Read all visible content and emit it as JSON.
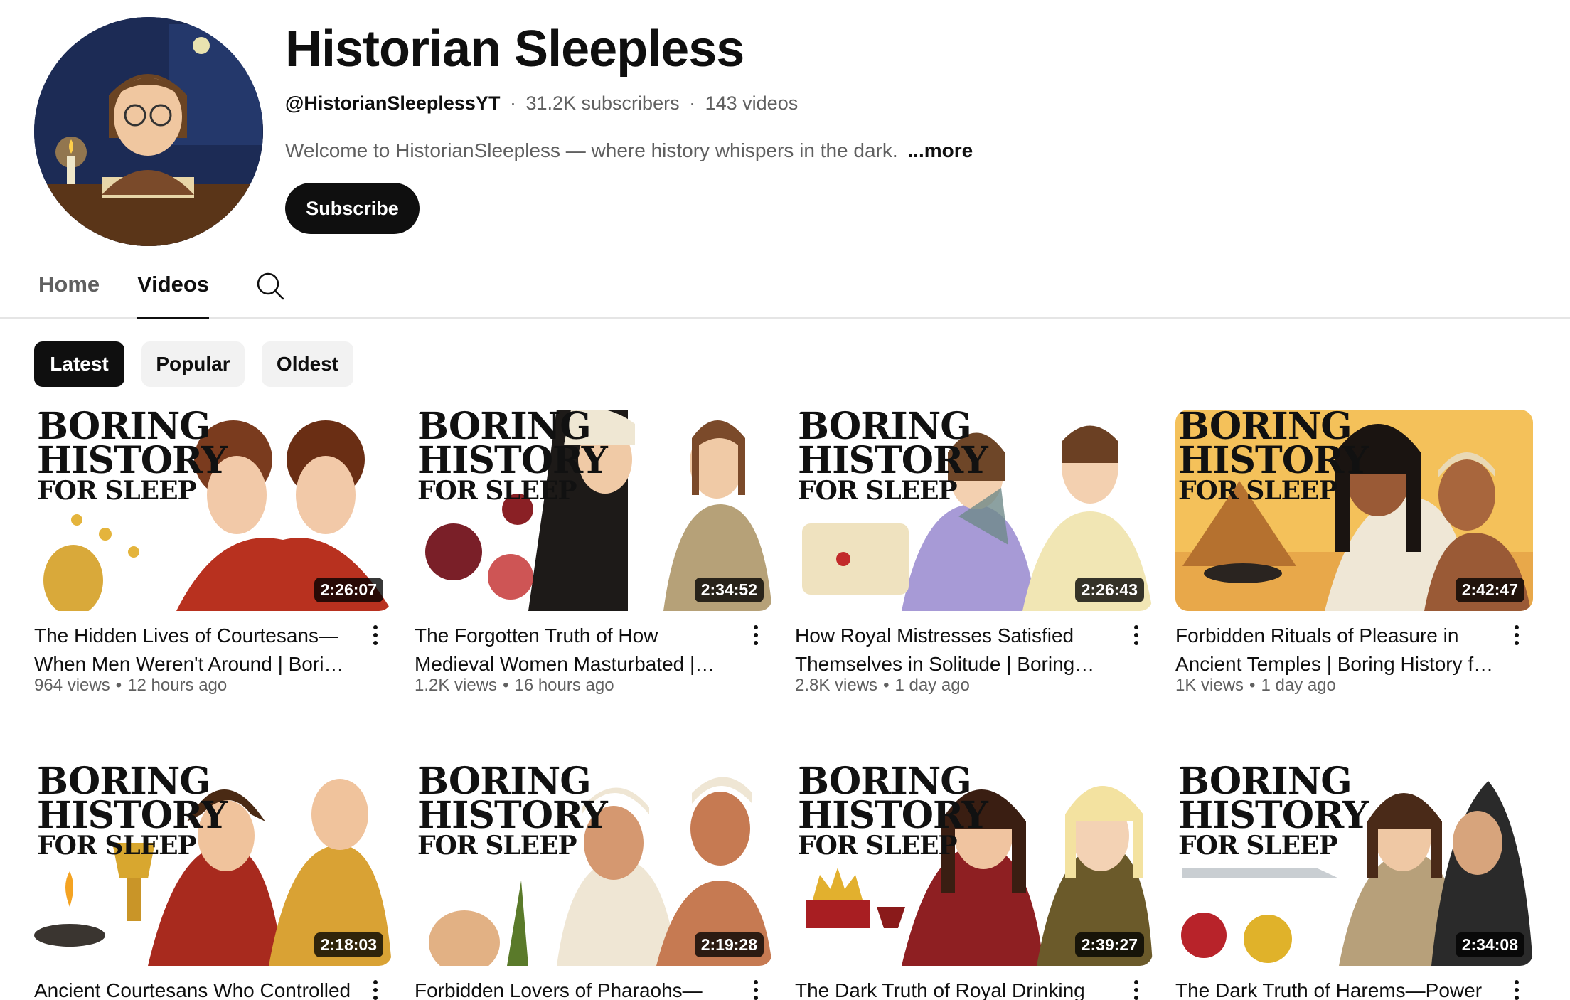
{
  "channel": {
    "name": "Historian Sleepless",
    "handle": "@HistorianSleeplessYT",
    "subscribers": "31.2K subscribers",
    "video_count": "143 videos",
    "meta_separator": "·",
    "description": "Welcome to HistorianSleepless — where history whispers in the dark.",
    "more_label": "...more",
    "subscribe_label": "Subscribe"
  },
  "tabs": [
    {
      "label": "Home",
      "active": false
    },
    {
      "label": "Videos",
      "active": true
    }
  ],
  "chips": [
    {
      "label": "Latest",
      "active": true
    },
    {
      "label": "Popular",
      "active": false
    },
    {
      "label": "Oldest",
      "active": false
    }
  ],
  "thumbnail_text": {
    "line1": "BORING",
    "line2": "HISTORY",
    "line3": "FOR SLEEP"
  },
  "meta_separator": "•",
  "videos": [
    {
      "title": "The Hidden Lives of Courtesans—When Men Weren't Around | Boring History for Sleep",
      "duration": "2:26:07",
      "views": "964 views",
      "age": "12 hours ago"
    },
    {
      "title": "The Forgotten Truth of How Medieval Women Masturbated | Boring History for Sleep",
      "duration": "2:34:52",
      "views": "1.2K views",
      "age": "16 hours ago"
    },
    {
      "title": "How Royal Mistresses Satisfied Themselves in Solitude | Boring History for Sleep",
      "duration": "2:26:43",
      "views": "2.8K views",
      "age": "1 day ago"
    },
    {
      "title": "Forbidden Rituals of Pleasure in Ancient Temples | Boring History for Sleep",
      "duration": "2:42:47",
      "views": "1K views",
      "age": "1 day ago"
    },
    {
      "title": "Ancient Courtesans Who Controlled",
      "duration": "2:18:03",
      "views": "",
      "age": ""
    },
    {
      "title": "Forbidden Lovers of Pharaohs—",
      "duration": "2:19:28",
      "views": "",
      "age": ""
    },
    {
      "title": "The Dark Truth of Royal Drinking",
      "duration": "2:39:27",
      "views": "",
      "age": ""
    },
    {
      "title": "The Dark Truth of Harems—Power",
      "duration": "2:34:08",
      "views": "",
      "age": ""
    }
  ],
  "icons": {
    "search": "search-icon",
    "more": "more-vert-icon"
  },
  "colors": {
    "text_primary": "#0f0f0f",
    "text_secondary": "#606060",
    "chip_bg": "#f2f2f2",
    "divider": "#e5e5e5"
  }
}
